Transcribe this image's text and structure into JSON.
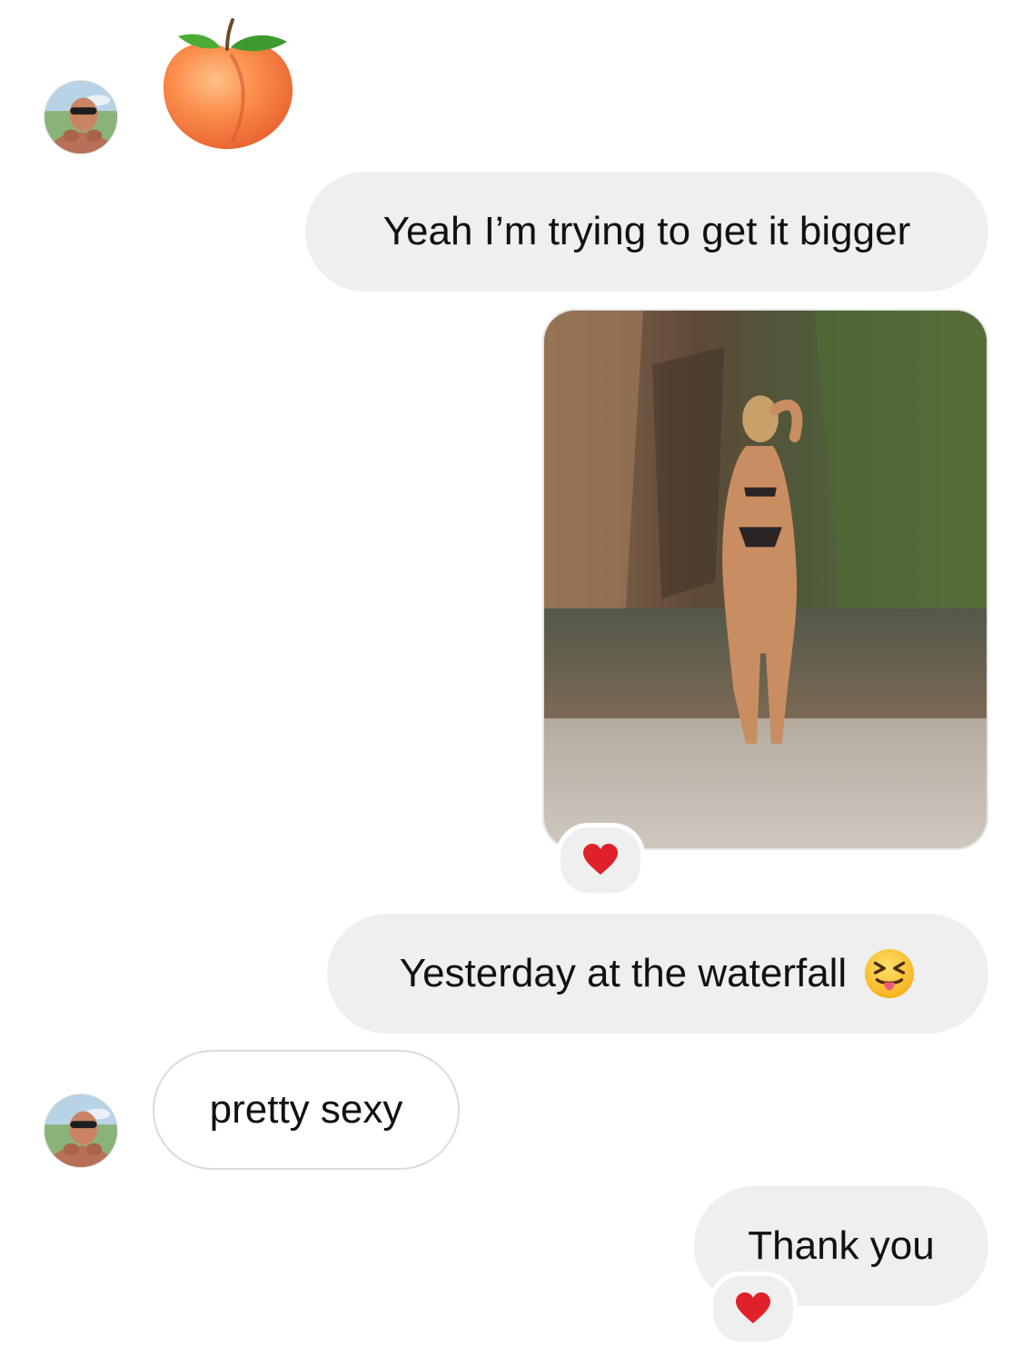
{
  "conversation": {
    "messages": [
      {
        "sender": "them",
        "type": "emoji",
        "emoji": "peach-emoji"
      },
      {
        "sender": "me",
        "type": "text",
        "text": "Yeah I’m trying to get it bigger"
      },
      {
        "sender": "me",
        "type": "photo",
        "reaction": "heart-emoji"
      },
      {
        "sender": "me",
        "type": "text",
        "text": "Yesterday at the waterfall",
        "trailing_emoji": "squinting-face-with-tongue-emoji"
      },
      {
        "sender": "them",
        "type": "text",
        "text": "pretty sexy"
      },
      {
        "sender": "me",
        "type": "text",
        "text": "Thank you",
        "reaction": "heart-emoji"
      }
    ]
  },
  "colors": {
    "outgoing_bubble": "#efefef",
    "incoming_bubble_border": "#dbdbdb",
    "reaction_heart": "#e0202a",
    "background": "#ffffff"
  }
}
